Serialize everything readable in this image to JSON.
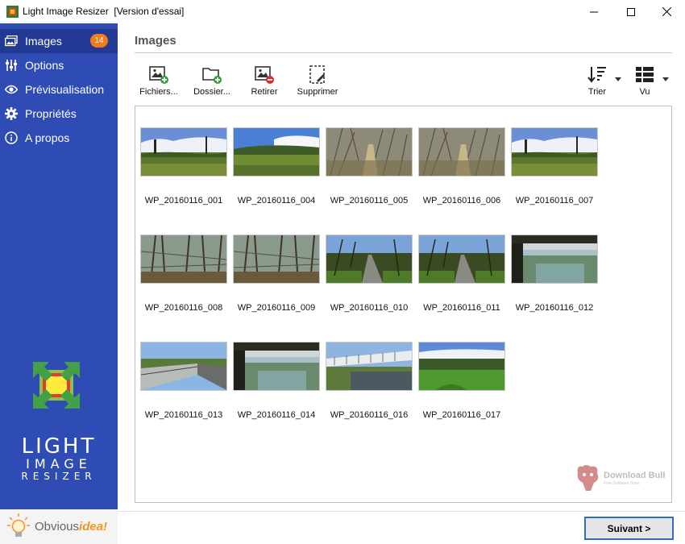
{
  "window": {
    "title": "Light Image Resizer  [Version d'essai]",
    "icon": "app-icon"
  },
  "sidebar": {
    "items": [
      {
        "label": "Images",
        "icon": "images-icon",
        "badge": "14",
        "active": true
      },
      {
        "label": "Options",
        "icon": "sliders-icon"
      },
      {
        "label": "Prévisualisation",
        "icon": "eye-icon"
      },
      {
        "label": "Propriétés",
        "icon": "gear-icon"
      },
      {
        "label": "A propos",
        "icon": "info-icon"
      }
    ],
    "brand": {
      "line1": "LIGHT",
      "line2": "IMAGE",
      "line3": "RESIZER"
    },
    "vendor": {
      "name_plain": "Obvious",
      "name_accent": "idea!"
    }
  },
  "main": {
    "title": "Images",
    "toolbar": {
      "add_files": "Fichiers...",
      "add_folder": "Dossier...",
      "remove": "Retirer",
      "delete": "Supprimer",
      "sort": "Trier",
      "view": "Vu"
    },
    "images": [
      {
        "name": "WP_20160116_001",
        "scene": "field"
      },
      {
        "name": "WP_20160116_004",
        "scene": "field2"
      },
      {
        "name": "WP_20160116_005",
        "scene": "path"
      },
      {
        "name": "WP_20160116_006",
        "scene": "path"
      },
      {
        "name": "WP_20160116_007",
        "scene": "field"
      },
      {
        "name": "WP_20160116_008",
        "scene": "woods"
      },
      {
        "name": "WP_20160116_009",
        "scene": "woods"
      },
      {
        "name": "WP_20160116_010",
        "scene": "road"
      },
      {
        "name": "WP_20160116_011",
        "scene": "road"
      },
      {
        "name": "WP_20160116_012",
        "scene": "bridge-dark"
      },
      {
        "name": "WP_20160116_013",
        "scene": "bridge"
      },
      {
        "name": "WP_20160116_014",
        "scene": "bridge-dark"
      },
      {
        "name": "WP_20160116_016",
        "scene": "bridge2"
      },
      {
        "name": "WP_20160116_017",
        "scene": "meadow"
      }
    ],
    "watermark": {
      "title": "Download Bull",
      "subtitle": "Free Software Store"
    },
    "next_button": "Suivant >"
  },
  "colors": {
    "sidebar": "#2f4cb5",
    "sidebar_active": "#233a94",
    "badge": "#f07c1a",
    "accent_border": "#2f6fbf"
  }
}
